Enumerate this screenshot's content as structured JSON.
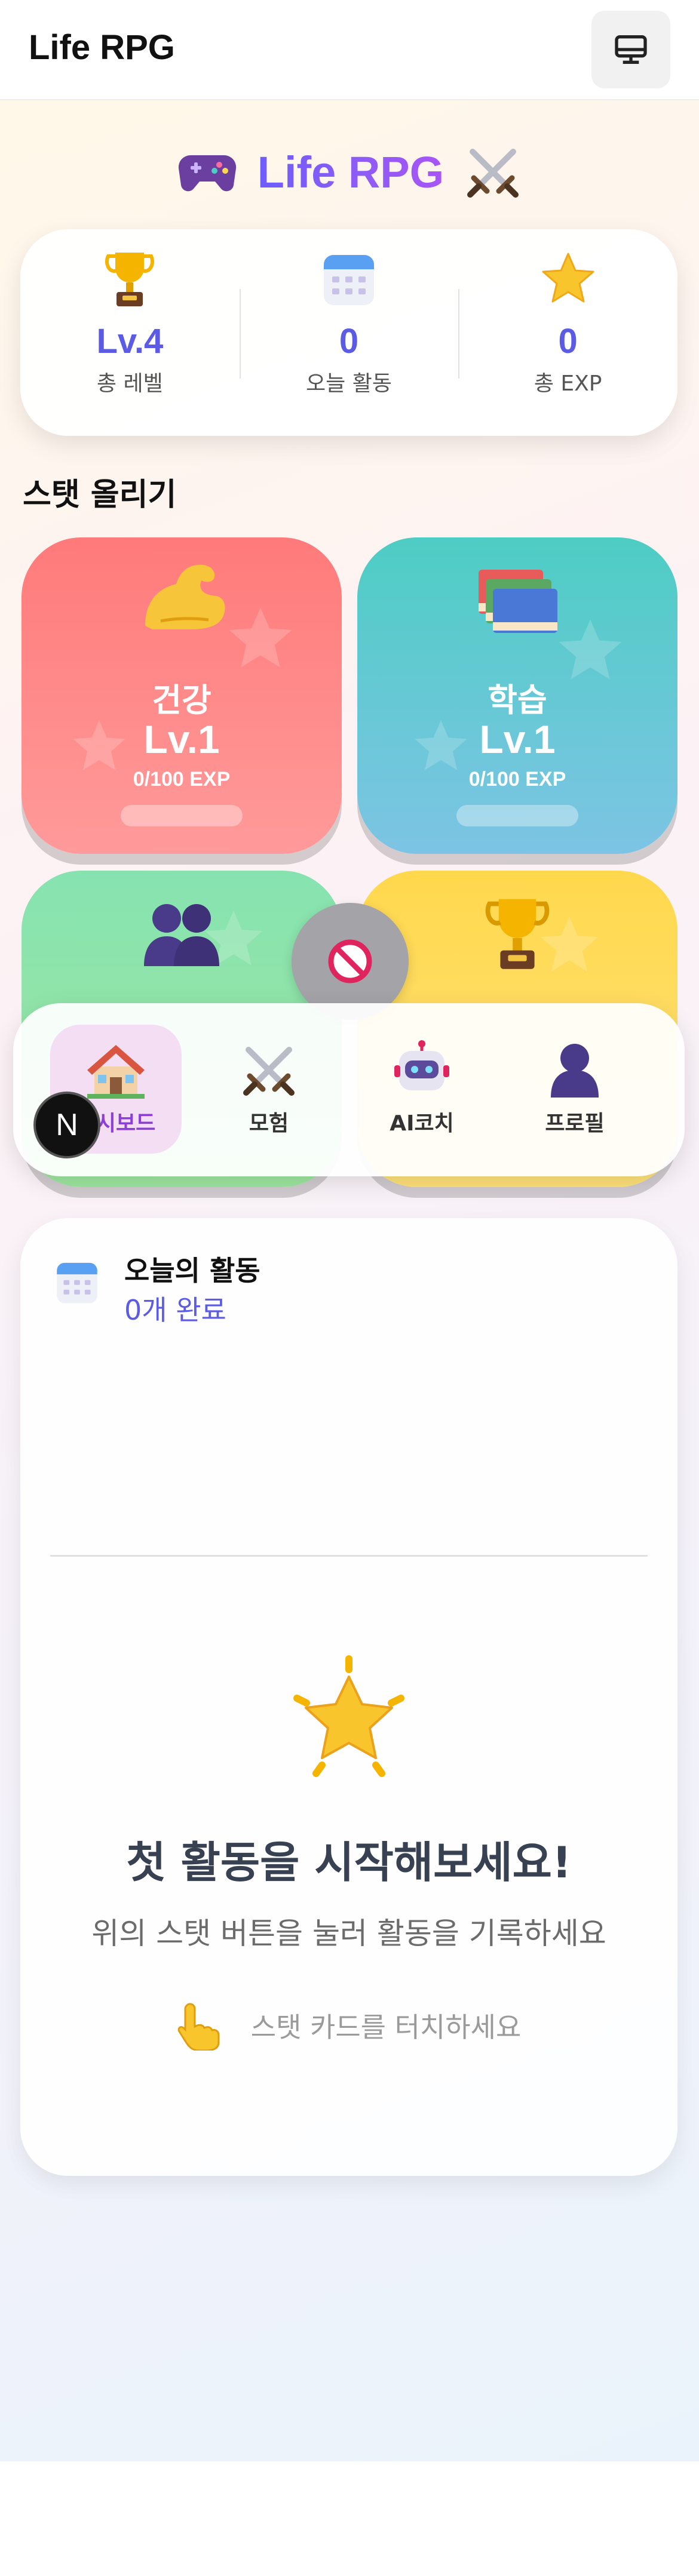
{
  "appbar": {
    "title": "Life RPG",
    "icon": "monitor-icon"
  },
  "hero": {
    "title": "Life RPG",
    "left_icon": "gamepad-icon",
    "right_icon": "crossed-swords-icon"
  },
  "summary": [
    {
      "icon": "trophy-icon",
      "value": "Lv.4",
      "label": "총 레벨"
    },
    {
      "icon": "calendar-icon",
      "value": "0",
      "label": "오늘 활동"
    },
    {
      "icon": "star-icon",
      "value": "0",
      "label": "총 EXP"
    }
  ],
  "section_title": "스탯 올리기",
  "stats": [
    {
      "name": "건강",
      "level": "Lv.1",
      "exp": "0/100 EXP",
      "progress": 0,
      "icon": "flexed-bicep-icon",
      "color": "#ff7a7a"
    },
    {
      "name": "학습",
      "level": "Lv.1",
      "exp": "0/100 EXP",
      "progress": 0,
      "icon": "books-icon",
      "color": "#4ecdc4"
    },
    {
      "name": "",
      "level": "",
      "exp": "",
      "progress": 0,
      "icon": "people-icon",
      "color": "#86e3b0"
    },
    {
      "name": "",
      "level": "",
      "exp": "",
      "progress": 0,
      "icon": "trophy-icon",
      "color": "#ffd84d"
    }
  ],
  "disabled_icon": "prohibited-icon",
  "nav": [
    {
      "label": "대시보드",
      "icon": "house-icon",
      "active": true
    },
    {
      "label": "모험",
      "icon": "crossed-swords-icon",
      "active": false
    },
    {
      "label": "AI코치",
      "icon": "robot-icon",
      "active": false
    },
    {
      "label": "프로필",
      "icon": "person-icon",
      "active": false
    }
  ],
  "dev_badge": "N",
  "activity": {
    "title": "오늘의 활동",
    "count": "0개 완료",
    "icon": "calendar-icon",
    "empty_icon": "glowing-star-icon",
    "empty_title": "첫 활동을 시작해보세요!",
    "empty_subtitle": "위의 스탯 버튼을 눌러 활동을 기록하세요",
    "hint_icon": "pointing-hand-icon",
    "hint_text": "스탯 카드를 터치하세요"
  }
}
